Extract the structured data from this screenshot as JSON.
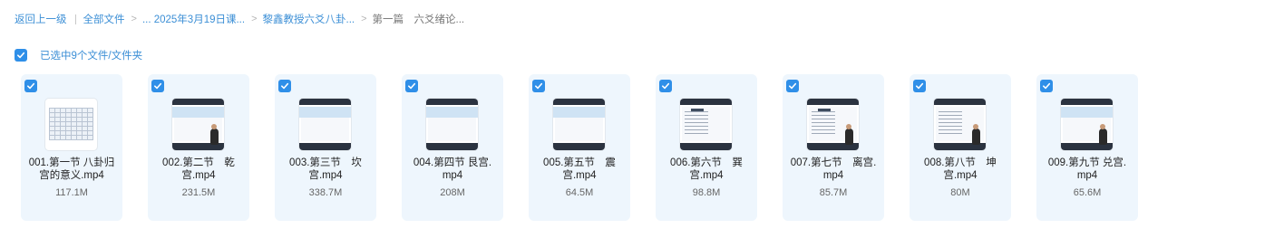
{
  "breadcrumb": {
    "back": "返回上一级",
    "all_files": "全部文件",
    "crumb1": "... 2025年3月19日课...",
    "crumb2": "黎鑫教授六爻八卦...",
    "current": "第一篇　六爻绪论..."
  },
  "selection": {
    "label": "已选中9个文件/文件夹",
    "checked": true
  },
  "colors": {
    "accent": "#2f8fe8",
    "link": "#3c8fd6",
    "card_bg": "#eef6fd"
  },
  "files": [
    {
      "name": "001.第一节 八卦归\n宫的意义.mp4",
      "size": "117.1M",
      "thumb": "grid"
    },
    {
      "name": "002.第二节　乾\n宫.mp4",
      "size": "231.5M",
      "thumb": "slide-person"
    },
    {
      "name": "003.第三节　坎\n宫.mp4",
      "size": "338.7M",
      "thumb": "slide"
    },
    {
      "name": "004.第四节 艮宫.\nmp4",
      "size": "208M",
      "thumb": "slide"
    },
    {
      "name": "005.第五节　震\n宫.mp4",
      "size": "64.5M",
      "thumb": "slide"
    },
    {
      "name": "006.第六节　巽\n宫.mp4",
      "size": "98.8M",
      "thumb": "doc"
    },
    {
      "name": "007.第七节　离宫.\nmp4",
      "size": "85.7M",
      "thumb": "doc-person"
    },
    {
      "name": "008.第八节　坤\n宫.mp4",
      "size": "80M",
      "thumb": "lines-person"
    },
    {
      "name": "009.第九节 兑宫.\nmp4",
      "size": "65.6M",
      "thumb": "slide-person"
    }
  ]
}
